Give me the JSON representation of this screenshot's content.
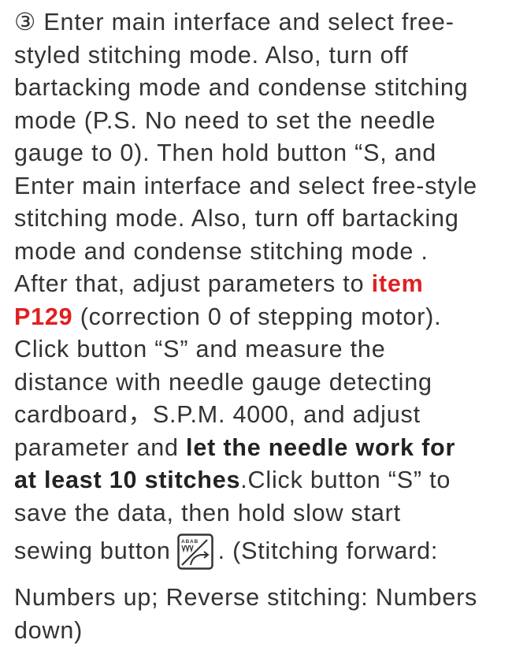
{
  "document": {
    "lines": [
      "③ Enter main interface and select free-",
      "styled stitching mode. Also, turn off",
      "bartacking mode and condense stitching",
      "mode (P.S. No need to set the needle",
      "gauge to 0). Then hold button  “S, and",
      "Enter main interface and select free-style",
      "stitching mode. Also, turn off bartacking",
      "mode and condense stitching mode .",
      "After that, adjust parameters to "
    ],
    "item_highlight_1": "item",
    "item_highlight_2": "P129",
    "line10_rest": " (correction 0 of stepping motor).",
    "line11": "Click button  “S” and measure the",
    "line12": "distance with needle gauge detecting",
    "line13": "cardboard，S.P.M. 4000, and adjust",
    "line14_plain": "parameter and ",
    "line14_bold": "let the needle work for",
    "line15_bold": "at least 10 stitches",
    "line15_rest": ".Click button  “S” to",
    "line16": "save the data, then hold slow start",
    "line17_before": "sewing button ",
    "line17_after": ". (Stitching forward:",
    "line18": "Numbers up; Reverse stitching: Numbers",
    "line19": "down)",
    "button_icon_label": "ABAB"
  }
}
